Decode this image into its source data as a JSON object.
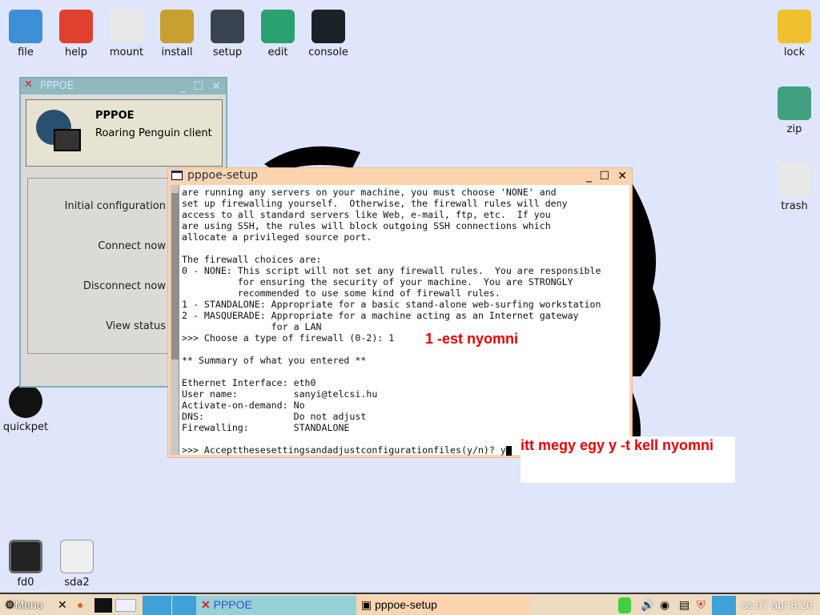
{
  "desktop": {
    "top_icons": [
      {
        "label": "file",
        "color": "#3d8fd6"
      },
      {
        "label": "help",
        "color": "#e04030"
      },
      {
        "label": "mount",
        "color": "#e8e8e8"
      },
      {
        "label": "install",
        "color": "#c8a030"
      },
      {
        "label": "setup",
        "color": "#3a4450"
      },
      {
        "label": "edit",
        "color": "#2aa070"
      },
      {
        "label": "console",
        "color": "#1a2228"
      }
    ],
    "right_icons": [
      {
        "label": "lock",
        "color": "#f0c030"
      },
      {
        "label": "zip",
        "color": "#40a080"
      },
      {
        "label": "trash",
        "color": "#e8e8e8"
      }
    ],
    "left_icons": [
      {
        "label": "quickpet"
      }
    ],
    "bottom_icons": [
      {
        "label": "fd0"
      },
      {
        "label": "sda2"
      }
    ]
  },
  "pppoe_window": {
    "title": "PPPOE",
    "app_name": "PPPOE",
    "app_desc": "Roaring Penguin client",
    "buttons": [
      "Initial configuration",
      "Connect now",
      "Disconnect now",
      "View status"
    ]
  },
  "terminal": {
    "title": "pppoe-setup",
    "lines": [
      "are running any servers on your machine, you must choose 'NONE' and",
      "set up firewalling yourself.  Otherwise, the firewall rules will deny",
      "access to all standard servers like Web, e-mail, ftp, etc.  If you",
      "are using SSH, the rules will block outgoing SSH connections which",
      "allocate a privileged source port.",
      "",
      "The firewall choices are:",
      "0 - NONE: This script will not set any firewall rules.  You are responsible",
      "          for ensuring the security of your machine.  You are STRONGLY",
      "          recommended to use some kind of firewall rules.",
      "1 - STANDALONE: Appropriate for a basic stand-alone web-surfing workstation",
      "2 - MASQUERADE: Appropriate for a machine acting as an Internet gateway",
      "                for a LAN",
      ">>> Choose a type of firewall (0-2): 1",
      "",
      "** Summary of what you entered **",
      "",
      "Ethernet Interface: eth0",
      "User name:          sanyi@telcsi.hu",
      "Activate-on-demand: No",
      "DNS:                Do not adjust",
      "Firewalling:        STANDALONE",
      "",
      ">>> Acceptthesesettingsandadjustconfigurationfiles(y/n)? y"
    ]
  },
  "annotations": {
    "first": "1 -est nyomni",
    "second": "itt megy egy y -t kell nyomni"
  },
  "taskbar": {
    "menu": "Menu",
    "tasks": [
      "PPPOE",
      "pppoe-setup"
    ],
    "clock": "cs 07 ápr  8:20"
  }
}
